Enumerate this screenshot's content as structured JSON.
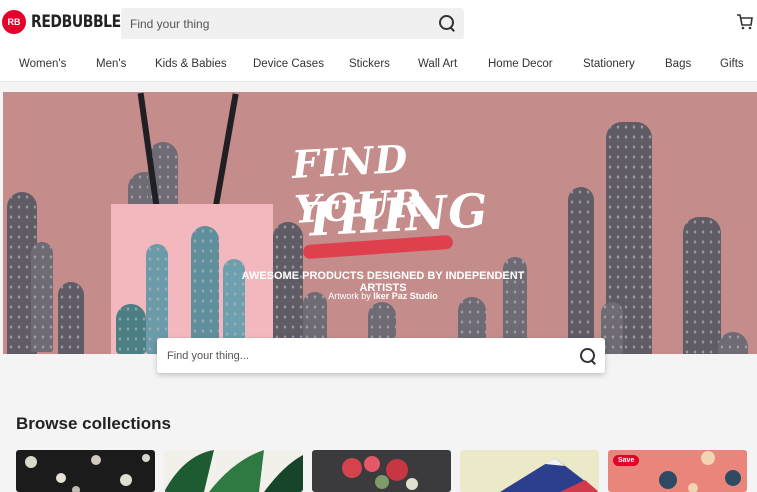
{
  "header": {
    "logo_badge": "RB",
    "logo_text": "REDBUBBLE",
    "search_placeholder": "Find your thing",
    "search_icon": "search-icon",
    "cart_icon": "cart-icon"
  },
  "nav": {
    "items": [
      "Women's",
      "Men's",
      "Kids & Babies",
      "Device Cases",
      "Stickers",
      "Wall Art",
      "Home Decor",
      "Stationery",
      "Bags",
      "Gifts"
    ]
  },
  "hero": {
    "title_line1": "Find your",
    "title_line2": "Thing",
    "tagline": "AWESOME PRODUCTS DESIGNED BY INDEPENDENT ARTISTS",
    "artwork_prefix": "Artwork by",
    "artist": "Iker Paz Studio",
    "search_placeholder": "Find your thing...",
    "brand_color": "#e4002b",
    "background_color": "#c48d8c"
  },
  "browse": {
    "title": "Browse collections",
    "save_label": "Save"
  }
}
